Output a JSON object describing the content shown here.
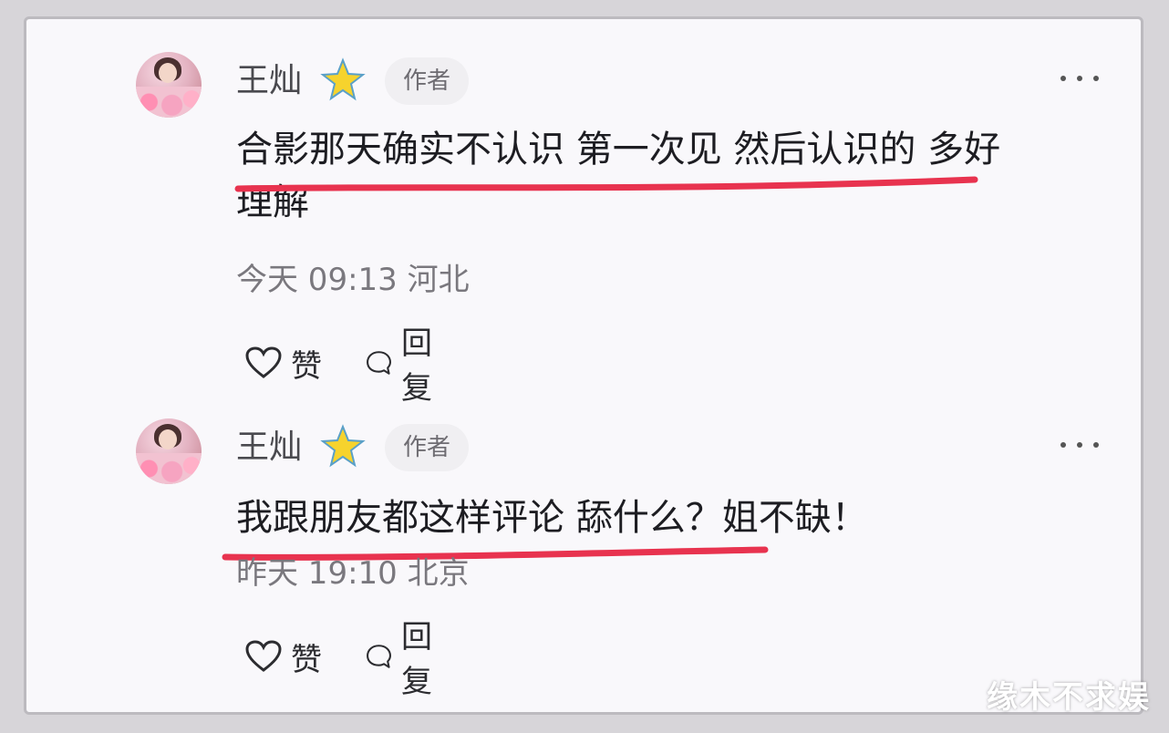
{
  "comments": [
    {
      "author": "王灿",
      "badge": "作者",
      "text": "合影那天确实不认识 第一次见 然后认识的 多好理解",
      "text_line1": "合影那天确实不认识 第一次见 然后认识的 多好",
      "text_line2": "理解",
      "time_location": "今天 09:13 河北",
      "like_label": "赞",
      "reply_label": "回复"
    },
    {
      "author": "王灿",
      "badge": "作者",
      "text": "我跟朋友都这样评论 舔什么？姐不缺！",
      "time_location": "昨天 19:10 北京",
      "like_label": "赞",
      "reply_label": "回复"
    }
  ],
  "icons": {
    "author_badge": "star-icon",
    "menu": "more-icon",
    "like": "heart-icon",
    "reply": "speech-bubble-icon"
  },
  "colors": {
    "underline": "#e8334f",
    "star": "#f6d32d",
    "background": "#f9f8fb"
  },
  "watermark": "缘木不求娱"
}
